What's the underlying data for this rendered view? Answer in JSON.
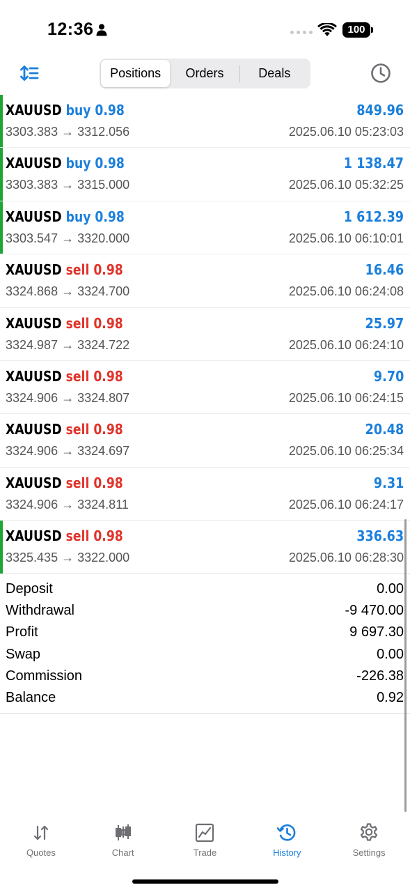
{
  "status_bar": {
    "time": "12:36",
    "battery": "100"
  },
  "toolbar": {
    "tabs": [
      {
        "label": "Positions",
        "active": true
      },
      {
        "label": "Orders",
        "active": false
      },
      {
        "label": "Deals",
        "active": false
      }
    ]
  },
  "deals": [
    {
      "symbol": "XAUUSD",
      "type": "buy 0.98",
      "direction": "buy",
      "prices": "3303.383 → 3312.056",
      "profit": "849.96",
      "time": "2025.06.10 05:23:03",
      "indicator": true
    },
    {
      "symbol": "XAUUSD",
      "type": "buy 0.98",
      "direction": "buy",
      "prices": "3303.383 → 3315.000",
      "profit": "1 138.47",
      "time": "2025.06.10 05:32:25",
      "indicator": true
    },
    {
      "symbol": "XAUUSD",
      "type": "buy 0.98",
      "direction": "buy",
      "prices": "3303.547 → 3320.000",
      "profit": "1 612.39",
      "time": "2025.06.10 06:10:01",
      "indicator": true
    },
    {
      "symbol": "XAUUSD",
      "type": "sell 0.98",
      "direction": "sell",
      "prices": "3324.868 → 3324.700",
      "profit": "16.46",
      "time": "2025.06.10 06:24:08",
      "indicator": false
    },
    {
      "symbol": "XAUUSD",
      "type": "sell 0.98",
      "direction": "sell",
      "prices": "3324.987 → 3324.722",
      "profit": "25.97",
      "time": "2025.06.10 06:24:10",
      "indicator": false
    },
    {
      "symbol": "XAUUSD",
      "type": "sell 0.98",
      "direction": "sell",
      "prices": "3324.906 → 3324.807",
      "profit": "9.70",
      "time": "2025.06.10 06:24:15",
      "indicator": false
    },
    {
      "symbol": "XAUUSD",
      "type": "sell 0.98",
      "direction": "sell",
      "prices": "3324.906 → 3324.697",
      "profit": "20.48",
      "time": "2025.06.10 06:25:34",
      "indicator": false
    },
    {
      "symbol": "XAUUSD",
      "type": "sell 0.98",
      "direction": "sell",
      "prices": "3324.906 → 3324.811",
      "profit": "9.31",
      "time": "2025.06.10 06:24:17",
      "indicator": false
    },
    {
      "symbol": "XAUUSD",
      "type": "sell 0.98",
      "direction": "sell",
      "prices": "3325.435 → 3322.000",
      "profit": "336.63",
      "time": "2025.06.10 06:28:30",
      "indicator": true
    }
  ],
  "summary": [
    {
      "label": "Deposit",
      "value": "0.00"
    },
    {
      "label": "Withdrawal",
      "value": "-9 470.00"
    },
    {
      "label": "Profit",
      "value": "9 697.30"
    },
    {
      "label": "Swap",
      "value": "0.00"
    },
    {
      "label": "Commission",
      "value": "-226.38"
    },
    {
      "label": "Balance",
      "value": "0.92"
    }
  ],
  "tabbar": [
    {
      "label": "Quotes",
      "icon": "quotes-icon",
      "active": false
    },
    {
      "label": "Chart",
      "icon": "chart-icon",
      "active": false
    },
    {
      "label": "Trade",
      "icon": "trade-icon",
      "active": false
    },
    {
      "label": "History",
      "icon": "history-icon",
      "active": true
    },
    {
      "label": "Settings",
      "icon": "settings-icon",
      "active": false
    }
  ],
  "colors": {
    "accent": "#1b7fdc",
    "sell": "#e0332a",
    "indicator": "#1fa534"
  }
}
